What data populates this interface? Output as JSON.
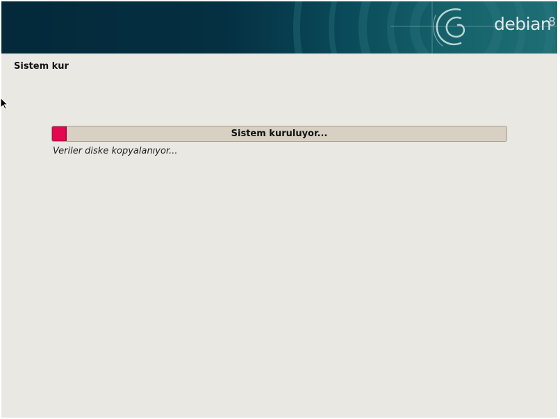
{
  "header": {
    "brand_name": "debian",
    "brand_version": "8",
    "logo_icon": "debian-swirl-icon"
  },
  "page": {
    "title": "Sistem kur"
  },
  "progress": {
    "label": "Sistem kuruluyor...",
    "fraction": 0.03,
    "fill_color": "#e3084f",
    "status": "Veriler diske kopyalanıyor..."
  },
  "colors": {
    "banner_dark": "#03293a",
    "banner_light": "#1f6f76",
    "background": "#e9e8e2"
  },
  "cursor_icon": "mouse-pointer-icon"
}
